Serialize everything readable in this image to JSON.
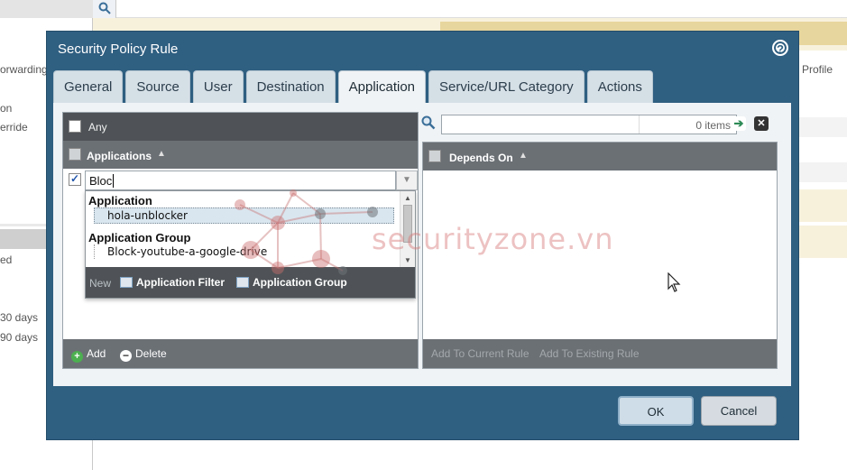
{
  "background": {
    "left_texts": [
      "orwarding",
      "on",
      "erride",
      "ed",
      "30 days",
      "90 days"
    ],
    "right_header": "Profile"
  },
  "dialog": {
    "title": "Security Policy Rule",
    "help_icon": "question-icon",
    "tabs": [
      "General",
      "Source",
      "User",
      "Destination",
      "Application",
      "Service/URL Category",
      "Actions"
    ],
    "active_tab": "Application"
  },
  "applications_panel": {
    "any_label": "Any",
    "header": "Applications",
    "search_value": "Bloc",
    "dropdown": {
      "groups": [
        {
          "label": "Application",
          "items": [
            "hola-unblocker"
          ]
        },
        {
          "label": "Application Group",
          "items": [
            "Block-youtube-a-google-drive"
          ]
        }
      ],
      "selected_item": "hola-unblocker",
      "new_label": "New",
      "new_buttons": [
        "Application Filter",
        "Application Group"
      ]
    },
    "add_label": "Add",
    "delete_label": "Delete"
  },
  "depends_panel": {
    "search_placeholder": "",
    "items_count": "0 items",
    "header": "Depends On",
    "add_current": "Add To Current Rule",
    "add_existing": "Add To Existing Rule"
  },
  "watermark": "securityzone.vn",
  "buttons": {
    "ok": "OK",
    "cancel": "Cancel"
  },
  "colors": {
    "dialog": "#2f5f81",
    "panel_header": "#6b7075",
    "tab_active": "#f0f3f5"
  }
}
